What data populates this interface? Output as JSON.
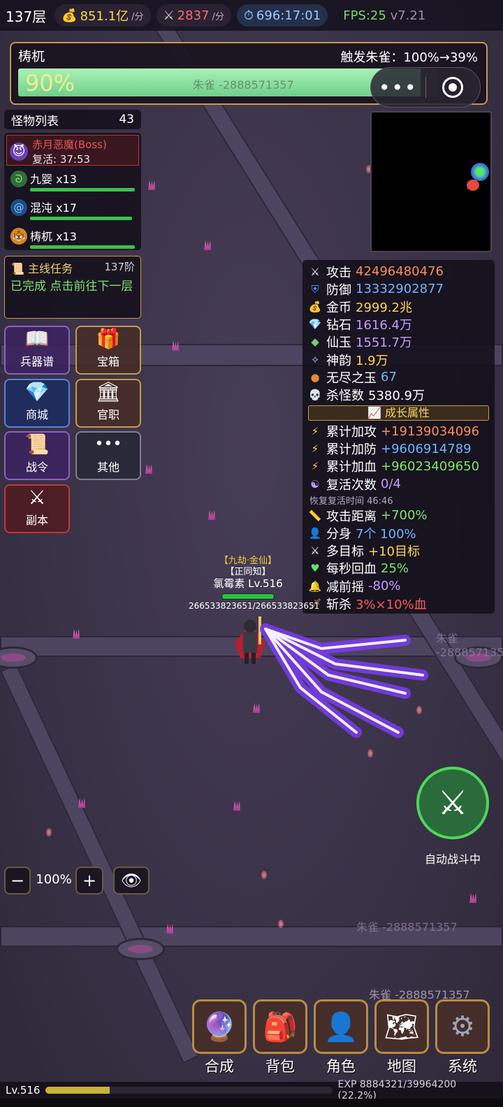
{
  "topbar": {
    "floor": "137层",
    "gold_rate": "851.1亿",
    "gold_unit": "/分",
    "kill_rate": "2837",
    "kill_unit": "/分",
    "timer": "696:17:01",
    "fps": "FPS:25",
    "version": "v7.21"
  },
  "boss_bar": {
    "name": "梼杌",
    "trigger": "触发朱雀：100%→39%",
    "percent_text": "90%",
    "progress": 0.96,
    "ghost_text": "朱雀 -2888571357"
  },
  "monster_list": {
    "title": "怪物列表",
    "count": "43",
    "boss": {
      "name": "赤月恶魔(Boss)",
      "revive": "复活: 37:53"
    },
    "items": [
      {
        "name": "九婴 x13",
        "icon": "snake-icon"
      },
      {
        "name": "混沌 x17",
        "icon": "swirl-icon"
      },
      {
        "name": "梼杌 x13",
        "icon": "tiger-icon"
      }
    ]
  },
  "quest": {
    "title": "主线任务",
    "level": "137阶",
    "text": "已完成 点击前往下一层"
  },
  "menu": {
    "weapons": "兵器谱",
    "chest": "宝箱",
    "shop": "商城",
    "office": "官职",
    "battlepass": "战令",
    "other": "其他",
    "dungeon": "副本"
  },
  "stats": {
    "rows": [
      {
        "label": "攻击",
        "value": "42496480476",
        "color": "#ff8c5a",
        "icon": "swords-icon"
      },
      {
        "label": "防御",
        "value": "13332902877",
        "color": "#6fb4ff",
        "icon": "shield-icon"
      },
      {
        "label": "金币",
        "value": "2999.2兆",
        "color": "#ffd54a",
        "icon": "moneybag-icon"
      },
      {
        "label": "钻石",
        "value": "1616.4万",
        "color": "#c89bff",
        "icon": "diamond-icon"
      },
      {
        "label": "仙玉",
        "value": "1551.7万",
        "color": "#c89bff",
        "icon": "jade-icon"
      },
      {
        "label": "神韵",
        "value": "1.9万",
        "color": "#ffd54a",
        "icon": "sparkle-icon"
      },
      {
        "label": "无尽之玉",
        "value": "67",
        "color": "#6fb4ff",
        "icon": "orb-icon"
      },
      {
        "label": "杀怪数",
        "value": "5380.9万",
        "color": "#ffffff",
        "icon": "skull-icon"
      }
    ],
    "growth_title": "成长属性",
    "growth": [
      {
        "label": "累计加攻",
        "value": "+19139034096",
        "color": "#ff8c5a"
      },
      {
        "label": "累计加防",
        "value": "+9606914789",
        "color": "#6fb4ff"
      },
      {
        "label": "累计加血",
        "value": "+96023409650",
        "color": "#7ee36d"
      }
    ],
    "revive": {
      "label": "复活次数",
      "value": "0/4"
    },
    "revive_time": "恢复复活时间 46:46",
    "extra": [
      {
        "label": "攻击距离",
        "value": "+700%",
        "color": "#7ee36d",
        "icon": "ruler-icon"
      },
      {
        "label": "分身",
        "value": "7个 100%",
        "color": "#6fb4ff",
        "icon": "person-icon"
      },
      {
        "label": "多目标",
        "value": "+10目标",
        "color": "#ffd54a",
        "icon": "swords-icon"
      },
      {
        "label": "每秒回血",
        "value": "25%",
        "color": "#7ee36d",
        "icon": "heart-icon"
      },
      {
        "label": "减前摇",
        "value": "-80%",
        "color": "#c89bff",
        "icon": "bell-icon"
      },
      {
        "label": "斩杀",
        "value": "3%×10%血",
        "color": "#ff5a5a",
        "icon": "sword-icon"
      }
    ]
  },
  "hero": {
    "title1": "【九劫·金仙】",
    "title2": "【正同知】",
    "name": "氯霉素 Lv.516",
    "hp": "266533823651/266533823651"
  },
  "auto_battle": "自动战斗中",
  "zoom": {
    "minus": "−",
    "value": "100%",
    "plus": "+"
  },
  "dock": {
    "compose": "合成",
    "bag": "背包",
    "role": "角色",
    "map": "地图",
    "system": "系统"
  },
  "floating": {
    "zhuque1": "朱雀 -2888571357",
    "zhuque2": "朱雀 -2888571357",
    "zhuque3": "朱雀 -2888571357"
  },
  "exp": {
    "level": "Lv.516",
    "text": "EXP 8884321/39964200 (22.2%)",
    "progress": 0.222
  }
}
